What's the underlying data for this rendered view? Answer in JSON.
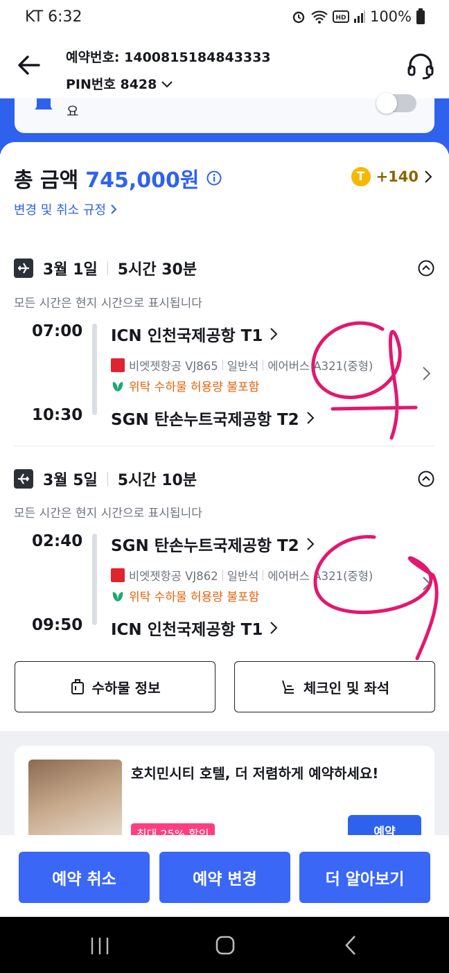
{
  "status_bar": {
    "carrier_time": "KT 6:32",
    "battery": "100%"
  },
  "header": {
    "booking_number": "예약번호: 1400815184843333",
    "pin": "PIN번호 8428",
    "icons": {
      "back": "arrow-left-icon",
      "support": "headset-icon"
    }
  },
  "notice": {
    "text": "요"
  },
  "summary": {
    "total_label": "총 금액",
    "total_amount": "745,000원",
    "points": "+140",
    "coin_symbol": "T",
    "policy_link": "변경 및 취소 규정"
  },
  "segments": [
    {
      "date": "3월 1일",
      "duration": "5시간 30분",
      "timezone_note": "모든 시간은 현지 시간으로 표시됩니다",
      "depart_time": "07:00",
      "depart_airport": "ICN  인천국제공항 T1",
      "airline": "비엣젯항공 VJ865",
      "cabin": "일반석",
      "aircraft": "에어버스 A321(중형)",
      "baggage": "위탁 수하물 허용량 불포함",
      "arrive_time": "10:30",
      "arrive_airport": "SGN  탄손누트국제공항 T2"
    },
    {
      "date": "3월 5일",
      "duration": "5시간 10분",
      "timezone_note": "모든 시간은 현지 시간으로 표시됩니다",
      "depart_time": "02:40",
      "depart_airport": "SGN  탄손누트국제공항 T2",
      "airline": "비엣젯항공 VJ862",
      "cabin": "일반석",
      "aircraft": "에어버스 A321(중형)",
      "baggage": "위탁 수하물 허용량 불포함",
      "arrive_time": "09:50",
      "arrive_airport": "ICN  인천국제공항 T1"
    }
  ],
  "actions": {
    "baggage_info": "수하물 정보",
    "checkin_seat": "체크인 및 좌석"
  },
  "promo": {
    "title": "호치민시티 호텔, 더 저렴하게 예약하세요!",
    "tag": "최대 25% 할인",
    "button": "예약"
  },
  "bottom_buttons": {
    "cancel": "예약 취소",
    "change": "예약 변경",
    "more": "더 알아보기"
  },
  "colors": {
    "accent": "#2f62ec",
    "button": "#3a67f5",
    "orange": "#e4620b",
    "scribble": "#e2186e"
  }
}
